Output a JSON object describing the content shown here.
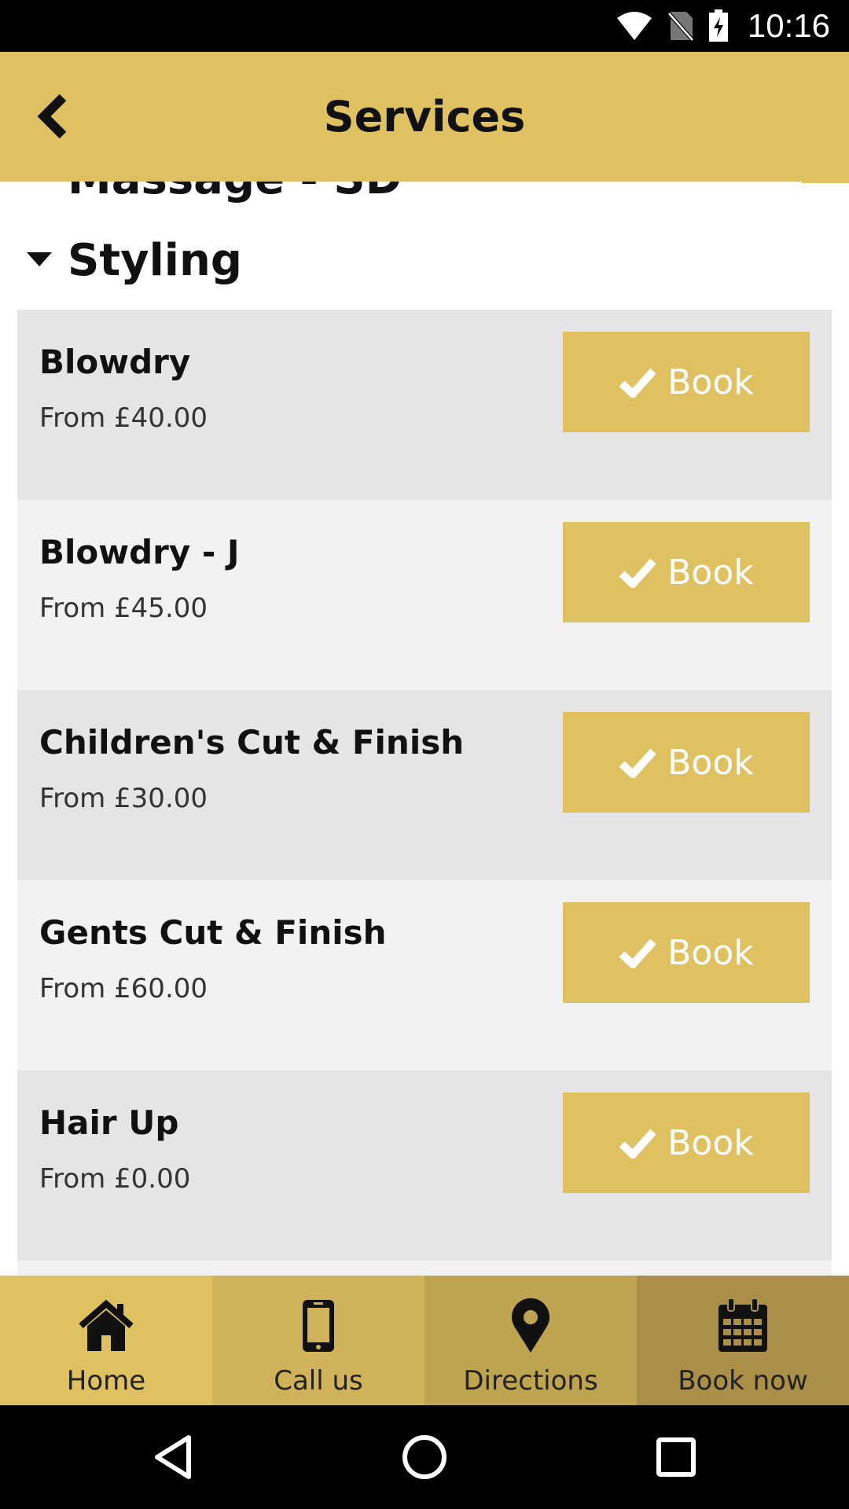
{
  "status_bar": {
    "time": "10:16",
    "icons": [
      "wifi-icon",
      "no-sim-icon",
      "battery-charging-icon"
    ]
  },
  "app_bar": {
    "title": "Services",
    "back_icon": "chevron-left-icon"
  },
  "content": {
    "clipped_header": "Massage - SD",
    "section": {
      "title": "Styling",
      "caret_icon": "caret-down-icon"
    },
    "services": [
      {
        "name": "Blowdry",
        "price": "From £40.00",
        "book_label": "Book"
      },
      {
        "name": "Blowdry - J",
        "price": "From £45.00",
        "book_label": "Book"
      },
      {
        "name": "Children's Cut & Finish",
        "price": "From £30.00",
        "book_label": "Book"
      },
      {
        "name": "Gents Cut & Finish",
        "price": "From £60.00",
        "book_label": "Book"
      },
      {
        "name": "Hair Up",
        "price": "From £0.00",
        "book_label": "Book"
      }
    ]
  },
  "bottom_nav": {
    "home": "Home",
    "call": "Call us",
    "directions": "Directions",
    "book_now": "Book now"
  },
  "colors": {
    "accent": "#e0c162",
    "row_dark": "#e5e5e5",
    "row_light": "#f2f2f2",
    "nav_home": "#e0c162",
    "nav_call": "#cfb259",
    "nav_directions": "#bea350",
    "nav_book": "#a98f47"
  }
}
